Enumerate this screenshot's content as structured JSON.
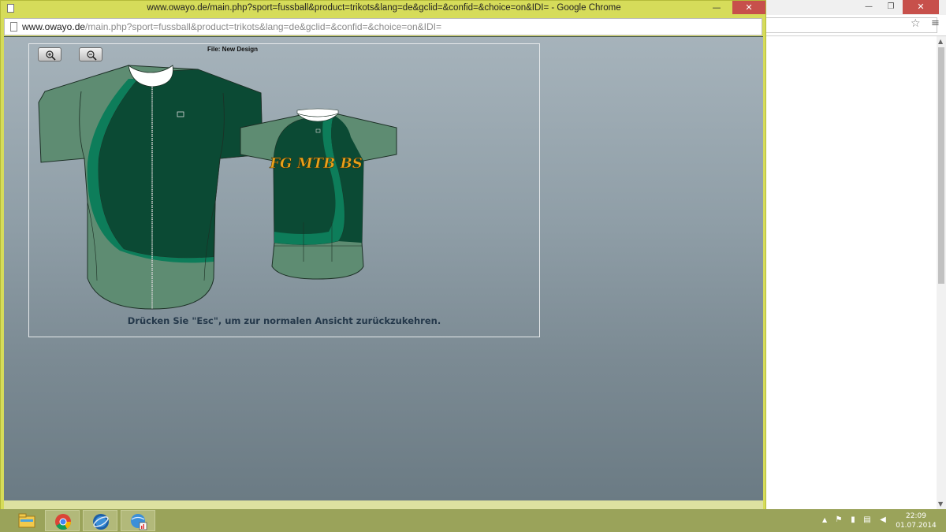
{
  "popup": {
    "title": "www.owayo.de/main.php?sport=fussball&product=trikots&lang=de&gclid=&confid=&choice=on&IDI= - Google Chrome",
    "address_host": "www.owayo.de",
    "address_path": "/main.php?sport=fussball&product=trikots&lang=de&gclid=&confid=&choice=on&IDI=",
    "minimize_glyph": "—",
    "close_glyph": "✕"
  },
  "design": {
    "file_label": "File: New Design",
    "jersey_text": "FG MTB BS",
    "esc_hint": "Drücken Sie \"Esc\", um zur normalen Ansicht zurückzukehren.",
    "colors": {
      "jersey_light": "#5e8c72",
      "jersey_dark": "#0b4a34",
      "stripe": "#0d7d5a",
      "collar": "#ffffff",
      "lettering": "#e8a21b"
    }
  },
  "bg_window": {
    "minimize_glyph": "—",
    "restore_glyph": "❐",
    "close_glyph": "✕",
    "star_glyph": "☆",
    "menu_glyph": "≡"
  },
  "taskbar": {
    "items": [
      {
        "name": "file-explorer-icon"
      },
      {
        "name": "chrome-icon"
      },
      {
        "name": "globe-app-icon"
      },
      {
        "name": "network-app-icon"
      }
    ],
    "tray_arrow": "▲",
    "time": "22:09",
    "date": "01.07.2014"
  }
}
